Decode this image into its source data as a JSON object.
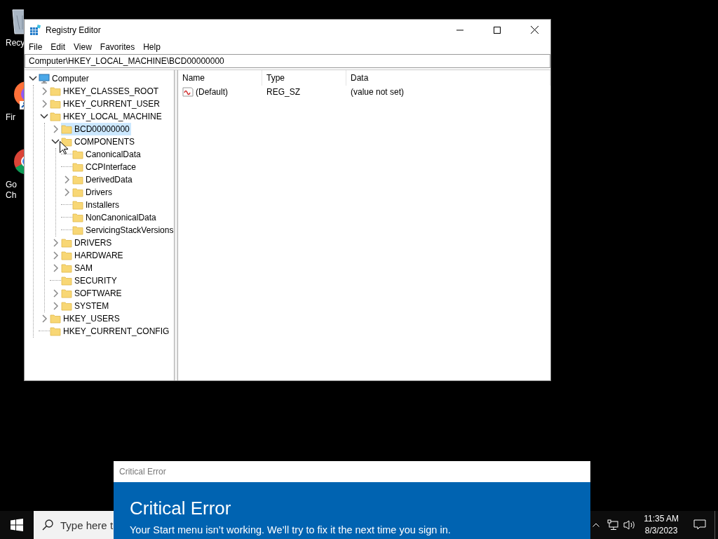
{
  "desktop_icons": [
    {
      "kind": "recycle",
      "label": "Recy"
    },
    {
      "kind": "firefox",
      "label": "Fir"
    },
    {
      "kind": "chrome",
      "label": "Go\nCh"
    }
  ],
  "window": {
    "title": "Registry Editor",
    "menu": [
      "File",
      "Edit",
      "View",
      "Favorites",
      "Help"
    ],
    "address": "Computer\\HKEY_LOCAL_MACHINE\\BCD00000000",
    "tree": [
      {
        "label": "Computer",
        "kind": "computer",
        "expanded": true,
        "selected": false,
        "children": [
          {
            "label": "HKEY_CLASSES_ROOT",
            "kind": "folder",
            "expanded": false,
            "selected": false
          },
          {
            "label": "HKEY_CURRENT_USER",
            "kind": "folder",
            "expanded": false,
            "selected": false
          },
          {
            "label": "HKEY_LOCAL_MACHINE",
            "kind": "folder",
            "expanded": true,
            "selected": false,
            "children": [
              {
                "label": "BCD00000000",
                "kind": "folder",
                "expanded": false,
                "selected": true
              },
              {
                "label": "COMPONENTS",
                "kind": "folder",
                "expanded": true,
                "selected": false,
                "children": [
                  {
                    "label": "CanonicalData",
                    "kind": "folder",
                    "selected": false
                  },
                  {
                    "label": "CCPInterface",
                    "kind": "folder",
                    "selected": false
                  },
                  {
                    "label": "DerivedData",
                    "kind": "folder",
                    "expanded": false,
                    "selected": false
                  },
                  {
                    "label": "Drivers",
                    "kind": "folder",
                    "expanded": false,
                    "selected": false
                  },
                  {
                    "label": "Installers",
                    "kind": "folder",
                    "selected": false
                  },
                  {
                    "label": "NonCanonicalData",
                    "kind": "folder",
                    "selected": false
                  },
                  {
                    "label": "ServicingStackVersions",
                    "kind": "folder",
                    "selected": false
                  }
                ]
              },
              {
                "label": "DRIVERS",
                "kind": "folder",
                "expanded": false,
                "selected": false
              },
              {
                "label": "HARDWARE",
                "kind": "folder",
                "expanded": false,
                "selected": false
              },
              {
                "label": "SAM",
                "kind": "folder",
                "expanded": false,
                "selected": false
              },
              {
                "label": "SECURITY",
                "kind": "folder",
                "selected": false
              },
              {
                "label": "SOFTWARE",
                "kind": "folder",
                "expanded": false,
                "selected": false
              },
              {
                "label": "SYSTEM",
                "kind": "folder",
                "expanded": false,
                "selected": false
              }
            ]
          },
          {
            "label": "HKEY_USERS",
            "kind": "folder",
            "expanded": false,
            "selected": false
          },
          {
            "label": "HKEY_CURRENT_CONFIG",
            "kind": "folder",
            "selected": false
          }
        ]
      }
    ],
    "columns": [
      "Name",
      "Type",
      "Data"
    ],
    "rows": [
      {
        "name": "(Default)",
        "type": "REG_SZ",
        "data": "(value not set)"
      }
    ]
  },
  "error_dialog": {
    "caption": "Critical Error",
    "heading": "Critical Error",
    "message": "Your Start menu isn’t working. We’ll try to fix it the next time you sign in."
  },
  "taskbar": {
    "search_placeholder": "Type here t",
    "time": "11:35 AM",
    "date": "8/3/2023"
  }
}
